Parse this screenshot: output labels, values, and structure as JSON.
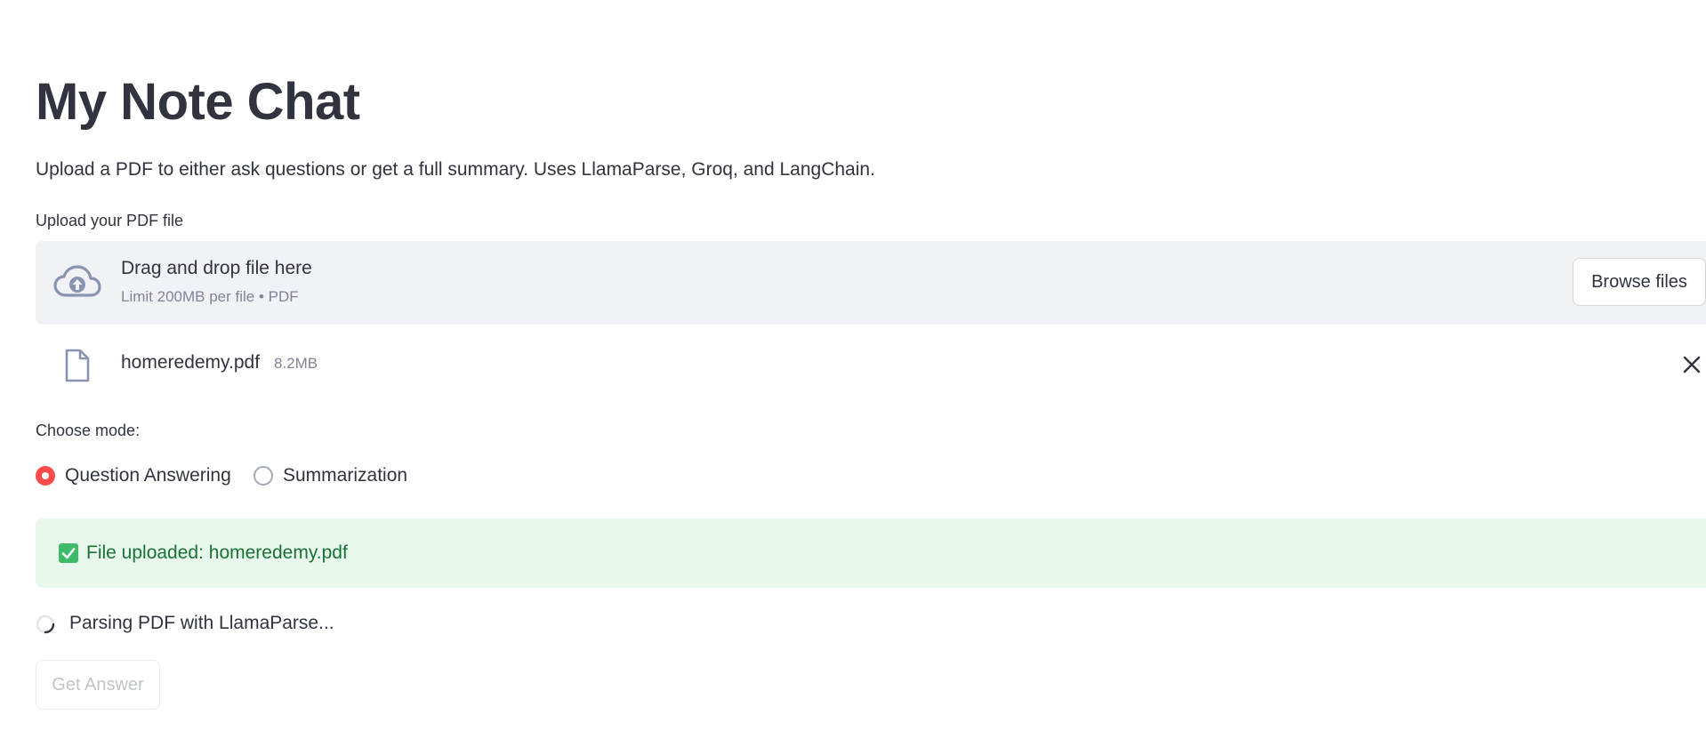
{
  "page": {
    "title": "My Note Chat",
    "subtitle": "Upload a PDF to either ask questions or get a full summary. Uses LlamaParse, Groq, and LangChain."
  },
  "uploader": {
    "label": "Upload your PDF file",
    "drop_title": "Drag and drop file here",
    "drop_limit": "Limit 200MB per file • PDF",
    "browse_label": "Browse files",
    "icon": "cloud-upload-icon"
  },
  "uploaded_file": {
    "name": "homeredemy.pdf",
    "size": "8.2MB",
    "icon": "file-icon",
    "remove_icon": "close-icon"
  },
  "mode": {
    "label": "Choose mode:",
    "options": [
      {
        "label": "Question Answering",
        "selected": true
      },
      {
        "label": "Summarization",
        "selected": false
      }
    ]
  },
  "status": {
    "success_text": "File uploaded: homeredemy.pdf",
    "spinner_text": "Parsing PDF with LlamaParse..."
  },
  "actions": {
    "get_answer_label": "Get Answer",
    "get_answer_disabled": true
  },
  "colors": {
    "text": "#31333f",
    "accent": "#ff4b4b",
    "success_bg": "#e8f8ec",
    "success_text": "#177233",
    "dropzone_bg": "#f0f2f6",
    "muted": "#808495"
  }
}
